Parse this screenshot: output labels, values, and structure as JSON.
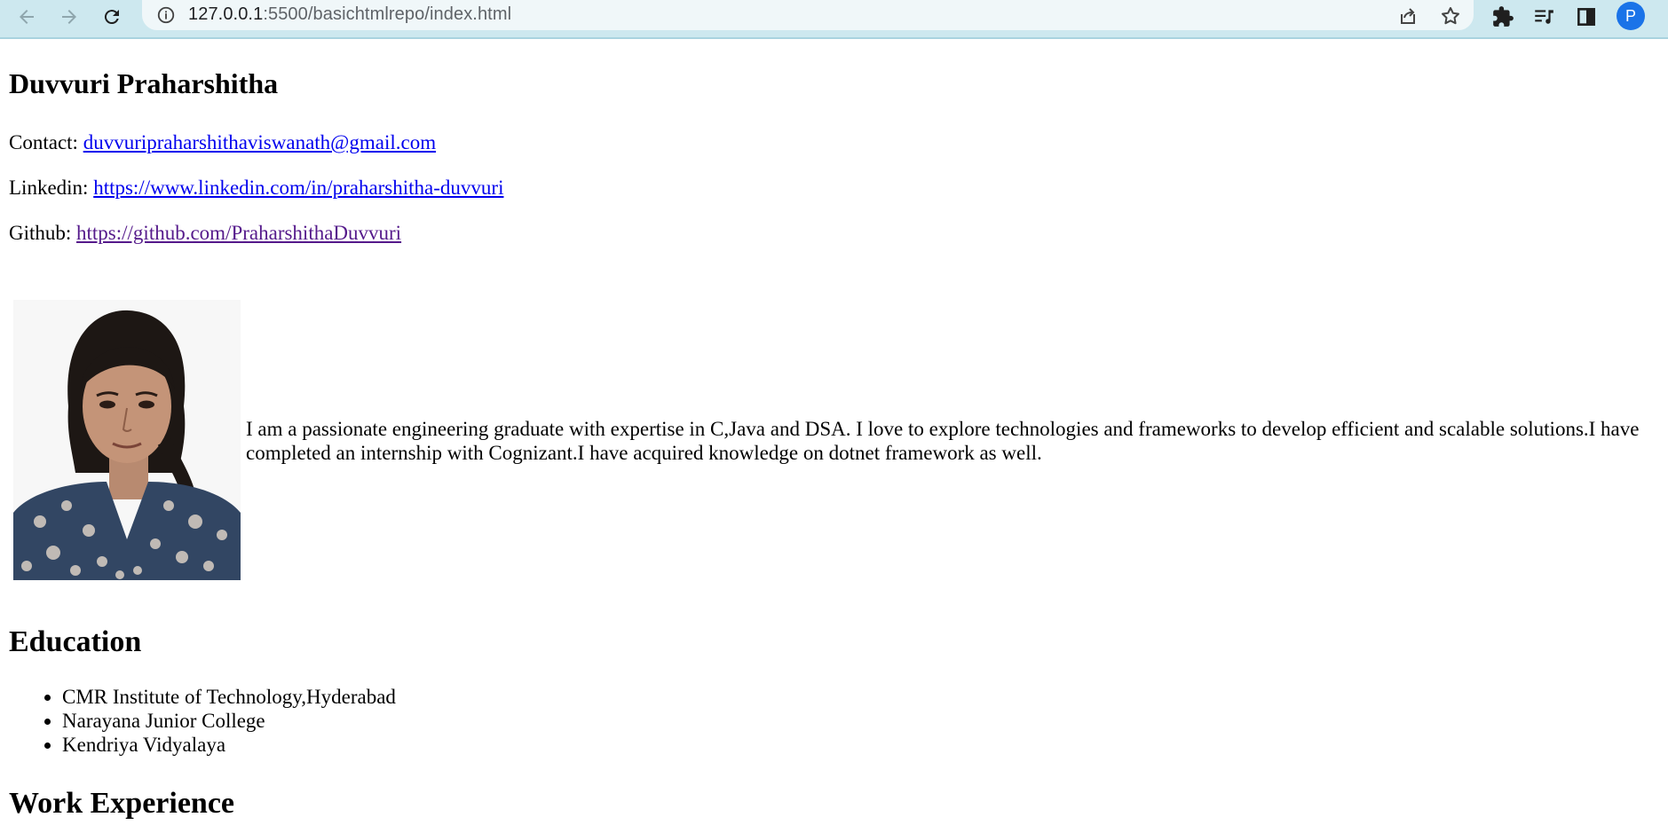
{
  "browser": {
    "url_host": "127.0.0.1",
    "url_rest": ":5500/basichtmlrepo/index.html",
    "profile_initial": "P",
    "icons": [
      "back-arrow-icon",
      "forward-arrow-icon",
      "reload-icon",
      "site-info-icon",
      "share-icon",
      "bookmark-star-icon",
      "extensions-puzzle-icon",
      "reading-list-icon",
      "side-panel-icon"
    ]
  },
  "profile": {
    "name": "Duvvuri Praharshitha",
    "contact_label": "Contact: ",
    "contact_email": "duvvuripraharshithaviswanath@gmail.com",
    "linkedin_label": "Linkedin: ",
    "linkedin_url": "https://www.linkedin.com/in/praharshitha-duvvuri",
    "github_label": "Github: ",
    "github_url": "https://github.com/PraharshithaDuvvuri"
  },
  "about": {
    "bio": "I am a passionate engineering graduate with expertise in C,Java and DSA. I love to explore technologies and frameworks to develop efficient and scalable solutions.I have completed an internship with Cognizant.I have acquired knowledge on dotnet framework as well."
  },
  "education": {
    "heading": "Education",
    "items": [
      "CMR Institute of Technology,Hyderabad",
      "Narayana Junior College",
      "Kendriya Vidyalaya"
    ]
  },
  "work": {
    "heading": "Work Experience"
  },
  "colors": {
    "link": "#0000ee",
    "visited_link": "#551a8b",
    "chrome_bg": "#cde8ef",
    "avatar_bg": "#1a73e8"
  }
}
